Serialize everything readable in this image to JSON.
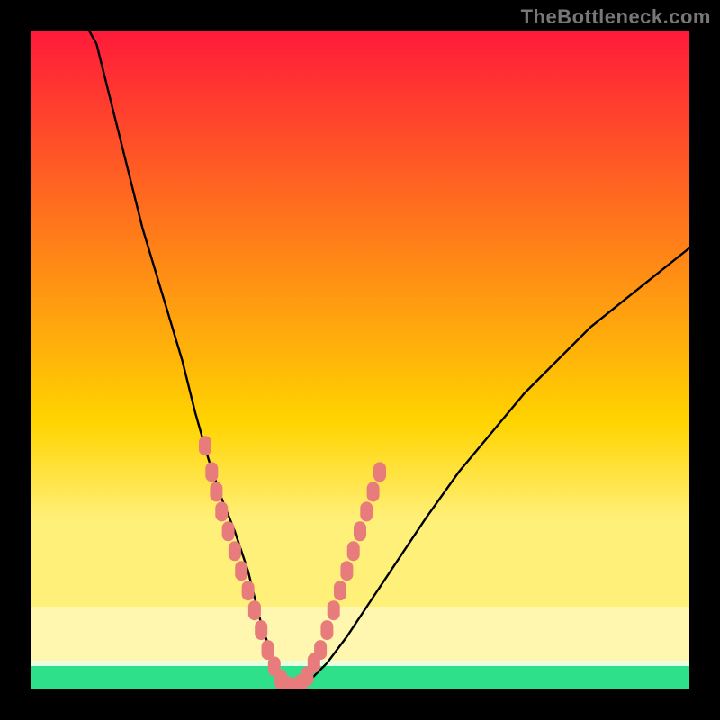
{
  "watermark": "TheBottleneck.com",
  "colors": {
    "frame": "#000000",
    "curve": "#000000",
    "marker": "#e87b7b",
    "grad_top": "#ff1a3a",
    "grad_mid": "#ffd400",
    "band_pale": "#fff7b0",
    "band_bottom": "#2fe08a"
  },
  "chart_data": {
    "type": "line",
    "title": "",
    "xlabel": "",
    "ylabel": "",
    "xlim": [
      0,
      100
    ],
    "ylim": [
      0,
      100
    ],
    "x": [
      0,
      5,
      10,
      15,
      17,
      20,
      23,
      25,
      27,
      29,
      31,
      33,
      34,
      35,
      36,
      37,
      38,
      40,
      42,
      45,
      48,
      52,
      56,
      60,
      65,
      70,
      75,
      80,
      85,
      90,
      95,
      100
    ],
    "values": [
      150,
      120,
      98,
      78,
      70,
      60,
      50,
      42,
      35,
      29,
      24,
      18,
      14,
      10,
      7,
      4,
      2,
      0,
      1,
      4,
      8,
      14,
      20,
      26,
      33,
      39,
      45,
      50,
      55,
      59,
      63,
      67
    ],
    "series": [
      {
        "name": "curve",
        "x": [
          0,
          5,
          10,
          15,
          17,
          20,
          23,
          25,
          27,
          29,
          31,
          33,
          34,
          35,
          36,
          37,
          38,
          40,
          42,
          45,
          48,
          52,
          56,
          60,
          65,
          70,
          75,
          80,
          85,
          90,
          95,
          100
        ],
        "values": [
          150,
          120,
          98,
          78,
          70,
          60,
          50,
          42,
          35,
          29,
          24,
          18,
          14,
          10,
          7,
          4,
          2,
          0,
          1,
          4,
          8,
          14,
          20,
          26,
          33,
          39,
          45,
          50,
          55,
          59,
          63,
          67
        ]
      }
    ],
    "markers": [
      {
        "x": 26.5,
        "y": 37
      },
      {
        "x": 27.5,
        "y": 33
      },
      {
        "x": 28.2,
        "y": 30
      },
      {
        "x": 29.0,
        "y": 27
      },
      {
        "x": 30.0,
        "y": 24
      },
      {
        "x": 31.0,
        "y": 21
      },
      {
        "x": 32.0,
        "y": 18
      },
      {
        "x": 33.0,
        "y": 15
      },
      {
        "x": 34.0,
        "y": 12
      },
      {
        "x": 35.0,
        "y": 9
      },
      {
        "x": 36.0,
        "y": 6
      },
      {
        "x": 37.0,
        "y": 3.5
      },
      {
        "x": 38.0,
        "y": 1.5
      },
      {
        "x": 39.0,
        "y": 0.5
      },
      {
        "x": 40.0,
        "y": 0.3
      },
      {
        "x": 41.0,
        "y": 0.8
      },
      {
        "x": 42.0,
        "y": 2
      },
      {
        "x": 43.0,
        "y": 4
      },
      {
        "x": 44.0,
        "y": 6
      },
      {
        "x": 45.0,
        "y": 9
      },
      {
        "x": 46.0,
        "y": 12
      },
      {
        "x": 47.0,
        "y": 15
      },
      {
        "x": 48.0,
        "y": 18
      },
      {
        "x": 49.0,
        "y": 21
      },
      {
        "x": 50.0,
        "y": 24
      },
      {
        "x": 51.0,
        "y": 27
      },
      {
        "x": 52.0,
        "y": 30
      },
      {
        "x": 53.0,
        "y": 33
      }
    ]
  }
}
